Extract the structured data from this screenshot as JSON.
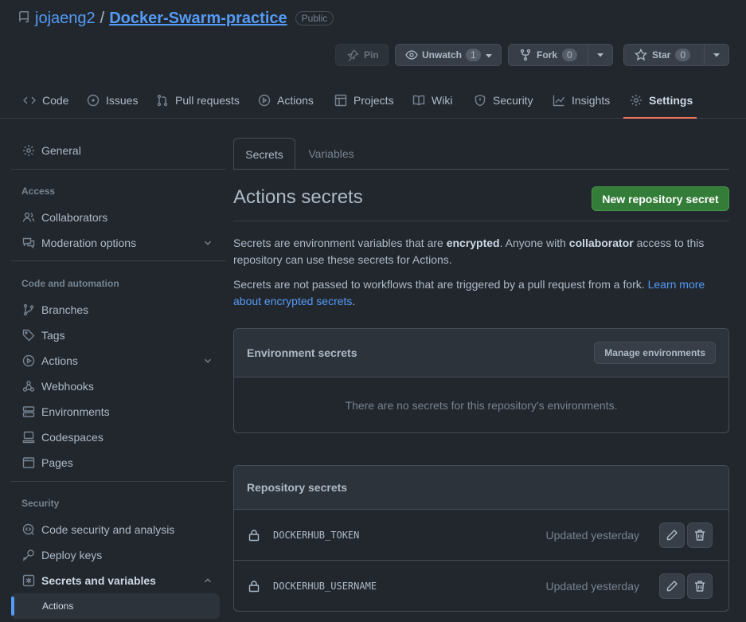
{
  "repo": {
    "owner": "jojaeng2",
    "separator": "/",
    "name": "Docker-Swarm-practice",
    "visibility": "Public"
  },
  "actions": {
    "pin": {
      "label": "Pin"
    },
    "watch": {
      "label": "Unwatch",
      "count": "1"
    },
    "fork": {
      "label": "Fork",
      "count": "0"
    },
    "star": {
      "label": "Star",
      "count": "0"
    }
  },
  "tabs": [
    {
      "label": "Code",
      "icon": "code-icon"
    },
    {
      "label": "Issues",
      "icon": "issue-icon"
    },
    {
      "label": "Pull requests",
      "icon": "pull-request-icon"
    },
    {
      "label": "Actions",
      "icon": "play-icon"
    },
    {
      "label": "Projects",
      "icon": "table-icon"
    },
    {
      "label": "Wiki",
      "icon": "book-icon"
    },
    {
      "label": "Security",
      "icon": "shield-icon"
    },
    {
      "label": "Insights",
      "icon": "graph-icon"
    },
    {
      "label": "Settings",
      "icon": "gear-icon",
      "selected": true
    }
  ],
  "sidebar": {
    "general": "General",
    "access_heading": "Access",
    "collaborators": "Collaborators",
    "moderation": "Moderation options",
    "code_heading": "Code and automation",
    "branches": "Branches",
    "tags": "Tags",
    "actions": "Actions",
    "webhooks": "Webhooks",
    "environments": "Environments",
    "codespaces": "Codespaces",
    "pages": "Pages",
    "security_heading": "Security",
    "code_security": "Code security and analysis",
    "deploy_keys": "Deploy keys",
    "secrets": "Secrets and variables",
    "secrets_actions": "Actions"
  },
  "main": {
    "subtabs": {
      "secrets": "Secrets",
      "variables": "Variables"
    },
    "title": "Actions secrets",
    "new_button": "New repository secret",
    "para1": {
      "a": "Secrets are environment variables that are ",
      "b": "encrypted",
      "c": ". Anyone with ",
      "d": "collaborator",
      "e": " access to this repository can use these secrets for Actions."
    },
    "para2": {
      "a": "Secrets are not passed to workflows that are triggered by a pull request from a fork. ",
      "link": "Learn more about encrypted secrets",
      "end": "."
    },
    "env_secrets": {
      "title": "Environment secrets",
      "manage_button": "Manage environments",
      "empty": "There are no secrets for this repository's environments."
    },
    "repo_secrets": {
      "title": "Repository secrets",
      "items": [
        {
          "name": "DOCKERHUB_TOKEN",
          "updated": "Updated yesterday"
        },
        {
          "name": "DOCKERHUB_USERNAME",
          "updated": "Updated yesterday"
        }
      ]
    }
  },
  "colors": {
    "background": "#22272e",
    "accent_link": "#539bf5",
    "primary_button": "#347d39",
    "selected_tab_underline": "#ec775c"
  }
}
